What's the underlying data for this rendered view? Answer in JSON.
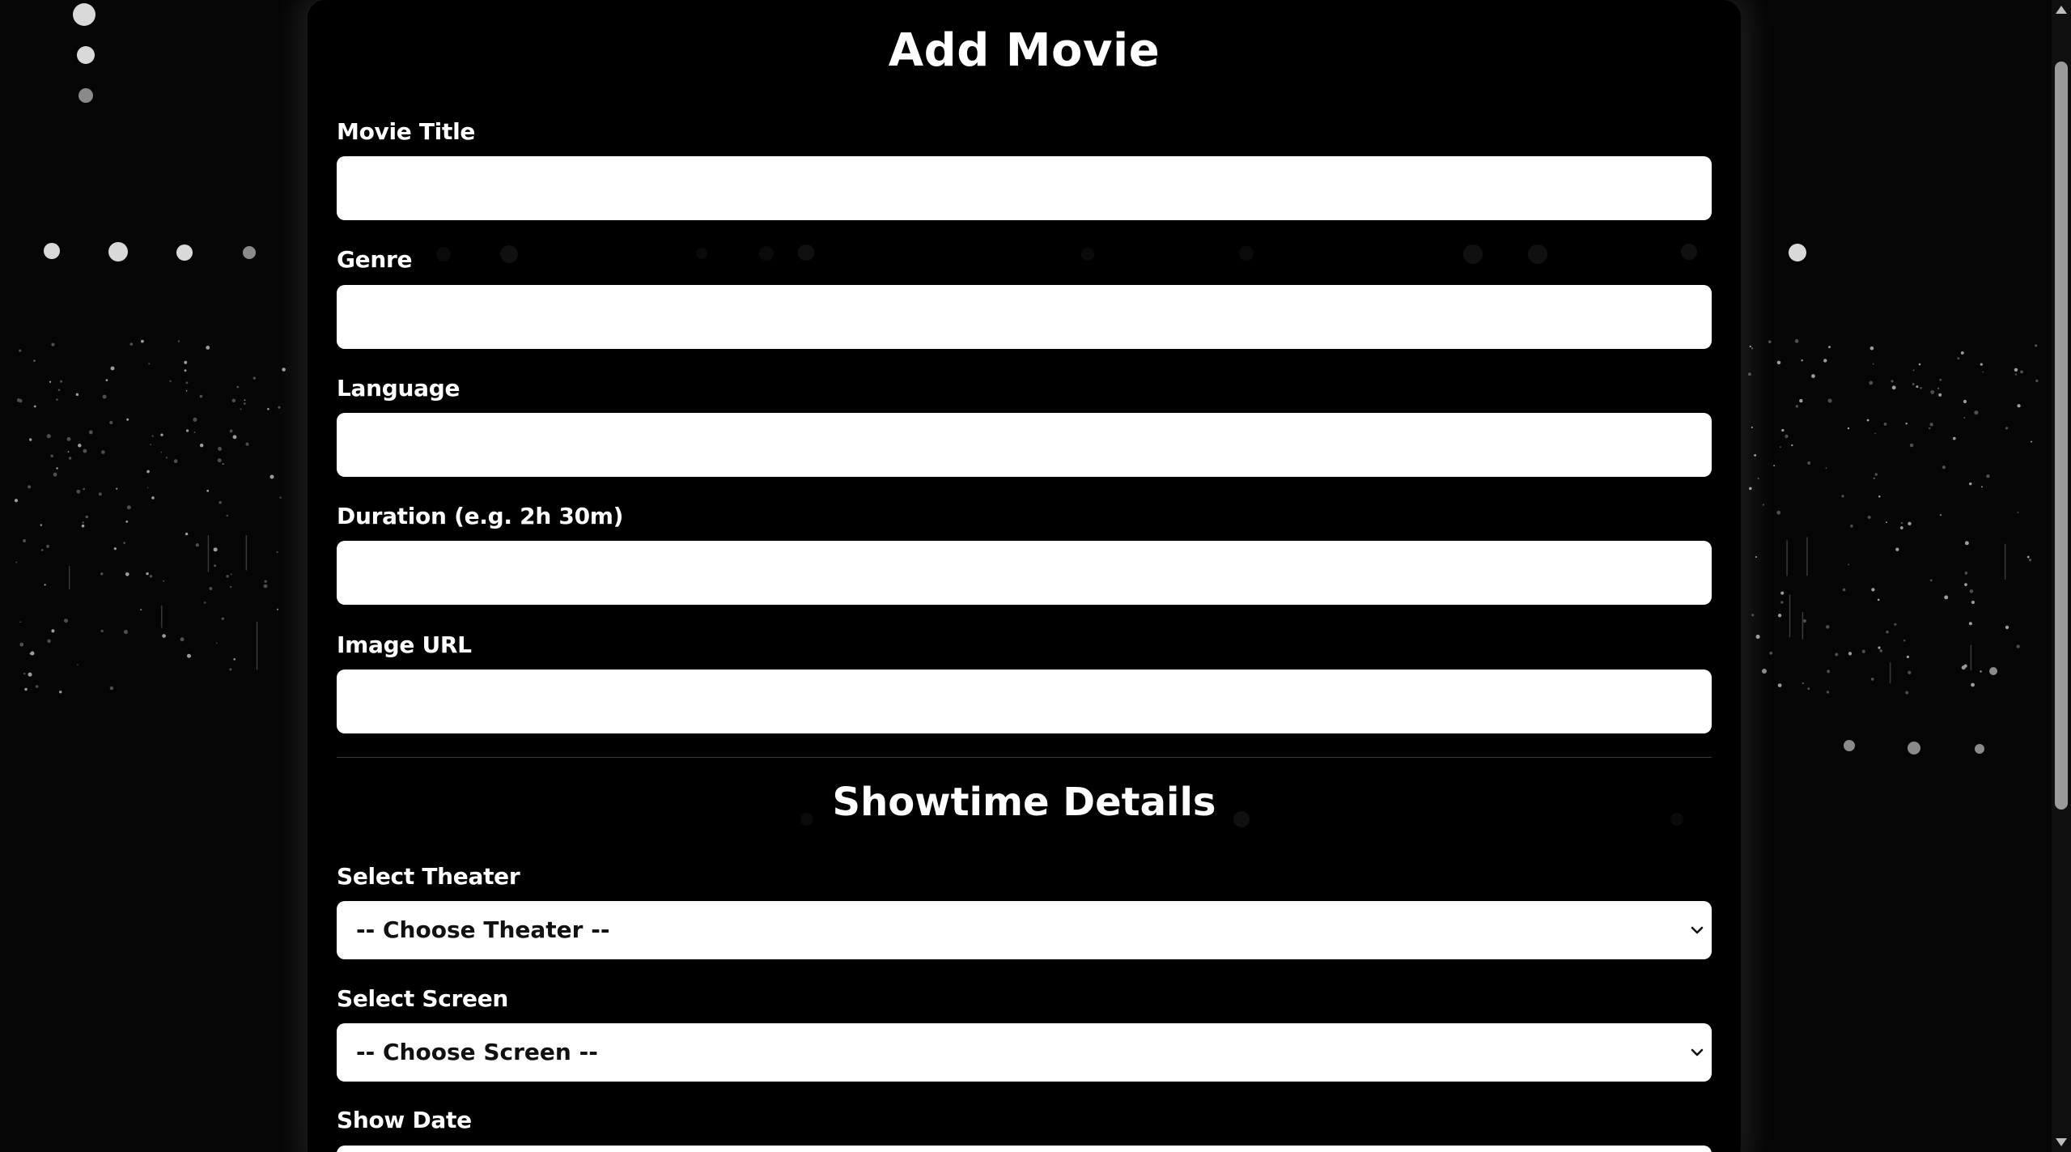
{
  "page": {
    "title": "Add Movie"
  },
  "fields": {
    "movie_title": {
      "label": "Movie Title",
      "value": "",
      "placeholder": ""
    },
    "genre": {
      "label": "Genre",
      "value": "",
      "placeholder": ""
    },
    "language": {
      "label": "Language",
      "value": "",
      "placeholder": ""
    },
    "duration": {
      "label": "Duration (e.g. 2h 30m)",
      "value": "",
      "placeholder": ""
    },
    "image_url": {
      "label": "Image URL",
      "value": "",
      "placeholder": ""
    }
  },
  "showtime": {
    "title": "Showtime Details",
    "theater": {
      "label": "Select Theater",
      "selected": "-- Choose Theater --"
    },
    "screen": {
      "label": "Select Screen",
      "selected": "-- Choose Screen --"
    },
    "show_date": {
      "label": "Show Date"
    }
  },
  "icons": {
    "select_arrow": "chevron-down-icon",
    "scroll_up": "triangle-up-icon",
    "scroll_down": "triangle-down-icon"
  },
  "colors": {
    "background": "#000000",
    "card": "#000000",
    "input": "#ffffff",
    "label": "#ffffff",
    "scroll_thumb": "#9a9a9a"
  }
}
